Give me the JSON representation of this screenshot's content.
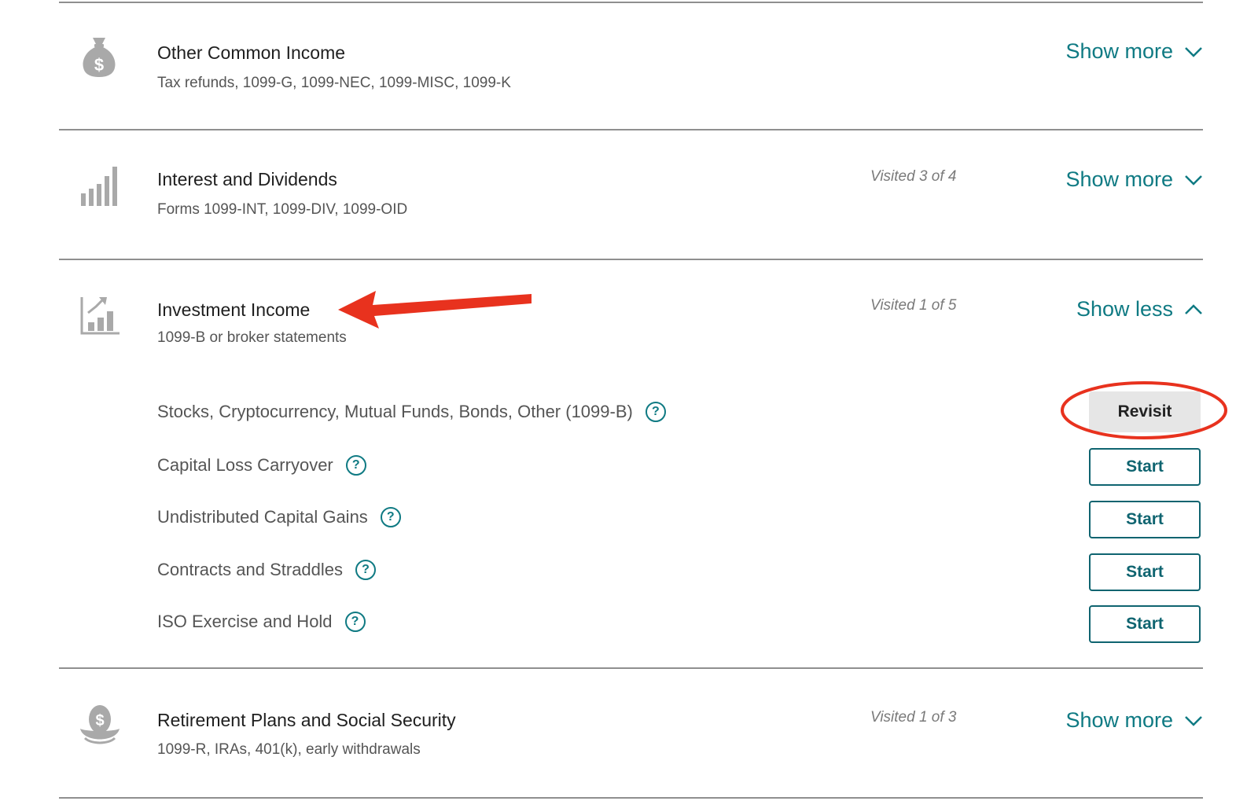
{
  "sections": [
    {
      "icon": "money-bag-icon",
      "title": "Other Common Income",
      "subtitle": "Tax refunds, 1099-G, 1099-NEC, 1099-MISC, 1099-K",
      "visited": "",
      "toggle": "Show more"
    },
    {
      "icon": "bar-signal-icon",
      "title": "Interest and Dividends",
      "subtitle": "Forms 1099-INT, 1099-DIV, 1099-OID",
      "visited": "Visited 3 of 4",
      "toggle": "Show more"
    },
    {
      "icon": "investment-chart-icon",
      "title": "Investment Income",
      "subtitle": "1099-B or broker statements",
      "visited": "Visited 1 of 5",
      "toggle": "Show less",
      "items": [
        {
          "label": "Stocks, Cryptocurrency, Mutual Funds, Bonds, Other (1099-B)",
          "action": "Revisit"
        },
        {
          "label": "Capital Loss Carryover",
          "action": "Start"
        },
        {
          "label": "Undistributed Capital Gains",
          "action": "Start"
        },
        {
          "label": "Contracts and Straddles",
          "action": "Start"
        },
        {
          "label": "ISO Exercise and Hold",
          "action": "Start"
        }
      ]
    },
    {
      "icon": "nest-egg-icon",
      "title": "Retirement Plans and Social Security",
      "subtitle": "1099-R, IRAs, 401(k), early withdrawals",
      "visited": "Visited 1 of 3",
      "toggle": "Show more"
    }
  ],
  "help_glyph": "?",
  "colors": {
    "accent": "#0f7a83",
    "annotation": "#e8321e"
  }
}
